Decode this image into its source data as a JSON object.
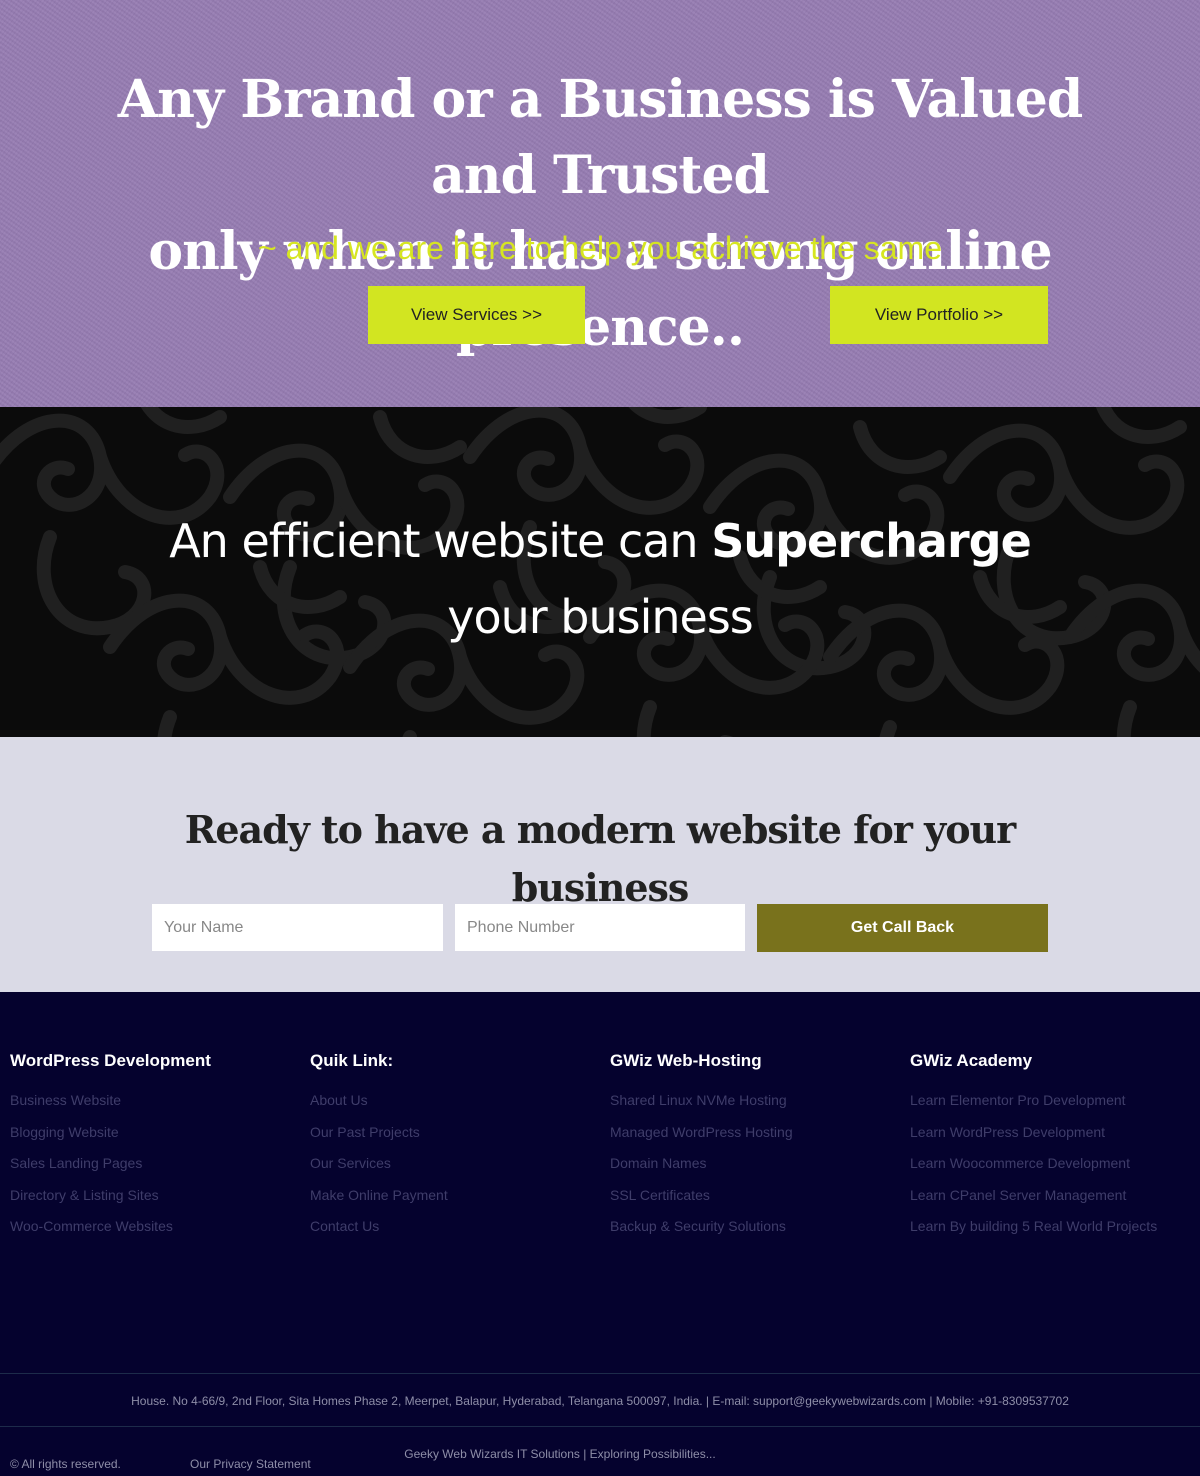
{
  "hero": {
    "title_line1": "Any Brand or a Business is Valued and Trusted",
    "title_line2": "only when it has a strong online presence..",
    "subtitle": "~ and we are here to help you achieve the same",
    "services_button": "View Services >>",
    "portfolio_button": "View Portfolio >>"
  },
  "supercharge": {
    "before": "An efficient website can ",
    "highlight": "Supercharge",
    "after": " your business"
  },
  "contact": {
    "title": "Ready to have a modern website for your business",
    "name_placeholder": "Your Name",
    "phone_placeholder": "Phone Number",
    "submit_label": "Get Call Back"
  },
  "footer": {
    "columns": [
      {
        "title": "WordPress Development",
        "links": [
          "Business Website",
          "Blogging Website",
          "Sales Landing Pages",
          "Directory & Listing Sites",
          "Woo-Commerce Websites"
        ]
      },
      {
        "title": "Quik Link:",
        "links": [
          "About Us",
          "Our Past Projects",
          "Our Services",
          "Make Online Payment",
          "Contact Us"
        ]
      },
      {
        "title": "GWiz Web-Hosting",
        "links": [
          "Shared Linux NVMe Hosting",
          "Managed WordPress Hosting",
          "Domain Names",
          "SSL Certificates",
          "Backup & Security Solutions"
        ]
      },
      {
        "title": "GWiz Academy",
        "links": [
          "Learn Elementor Pro Development",
          "Learn WordPress Development",
          "Learn Woocommerce Development",
          "Learn CPanel Server Management",
          "Learn By building 5 Real World Projects"
        ]
      }
    ],
    "address": "House. No 4-66/9, 2nd Floor, Sita Homes Phase 2, Meerpet, Balapur, Hyderabad, Telangana 500097, India. | E-mail: support@geekywebwizards.com | Mobile: +91-8309537702",
    "copyright": "© All rights reserved.",
    "privacy": "Our Privacy Statement",
    "tagline": "Geeky Web Wizards IT Solutions | Exploring Possibilities..."
  },
  "colors": {
    "hero_bg": "#967cb2",
    "accent_lime": "#d2e521",
    "callback_olive": "#79721c",
    "footer_bg": "#05022e",
    "contact_bg": "#dadae6"
  }
}
